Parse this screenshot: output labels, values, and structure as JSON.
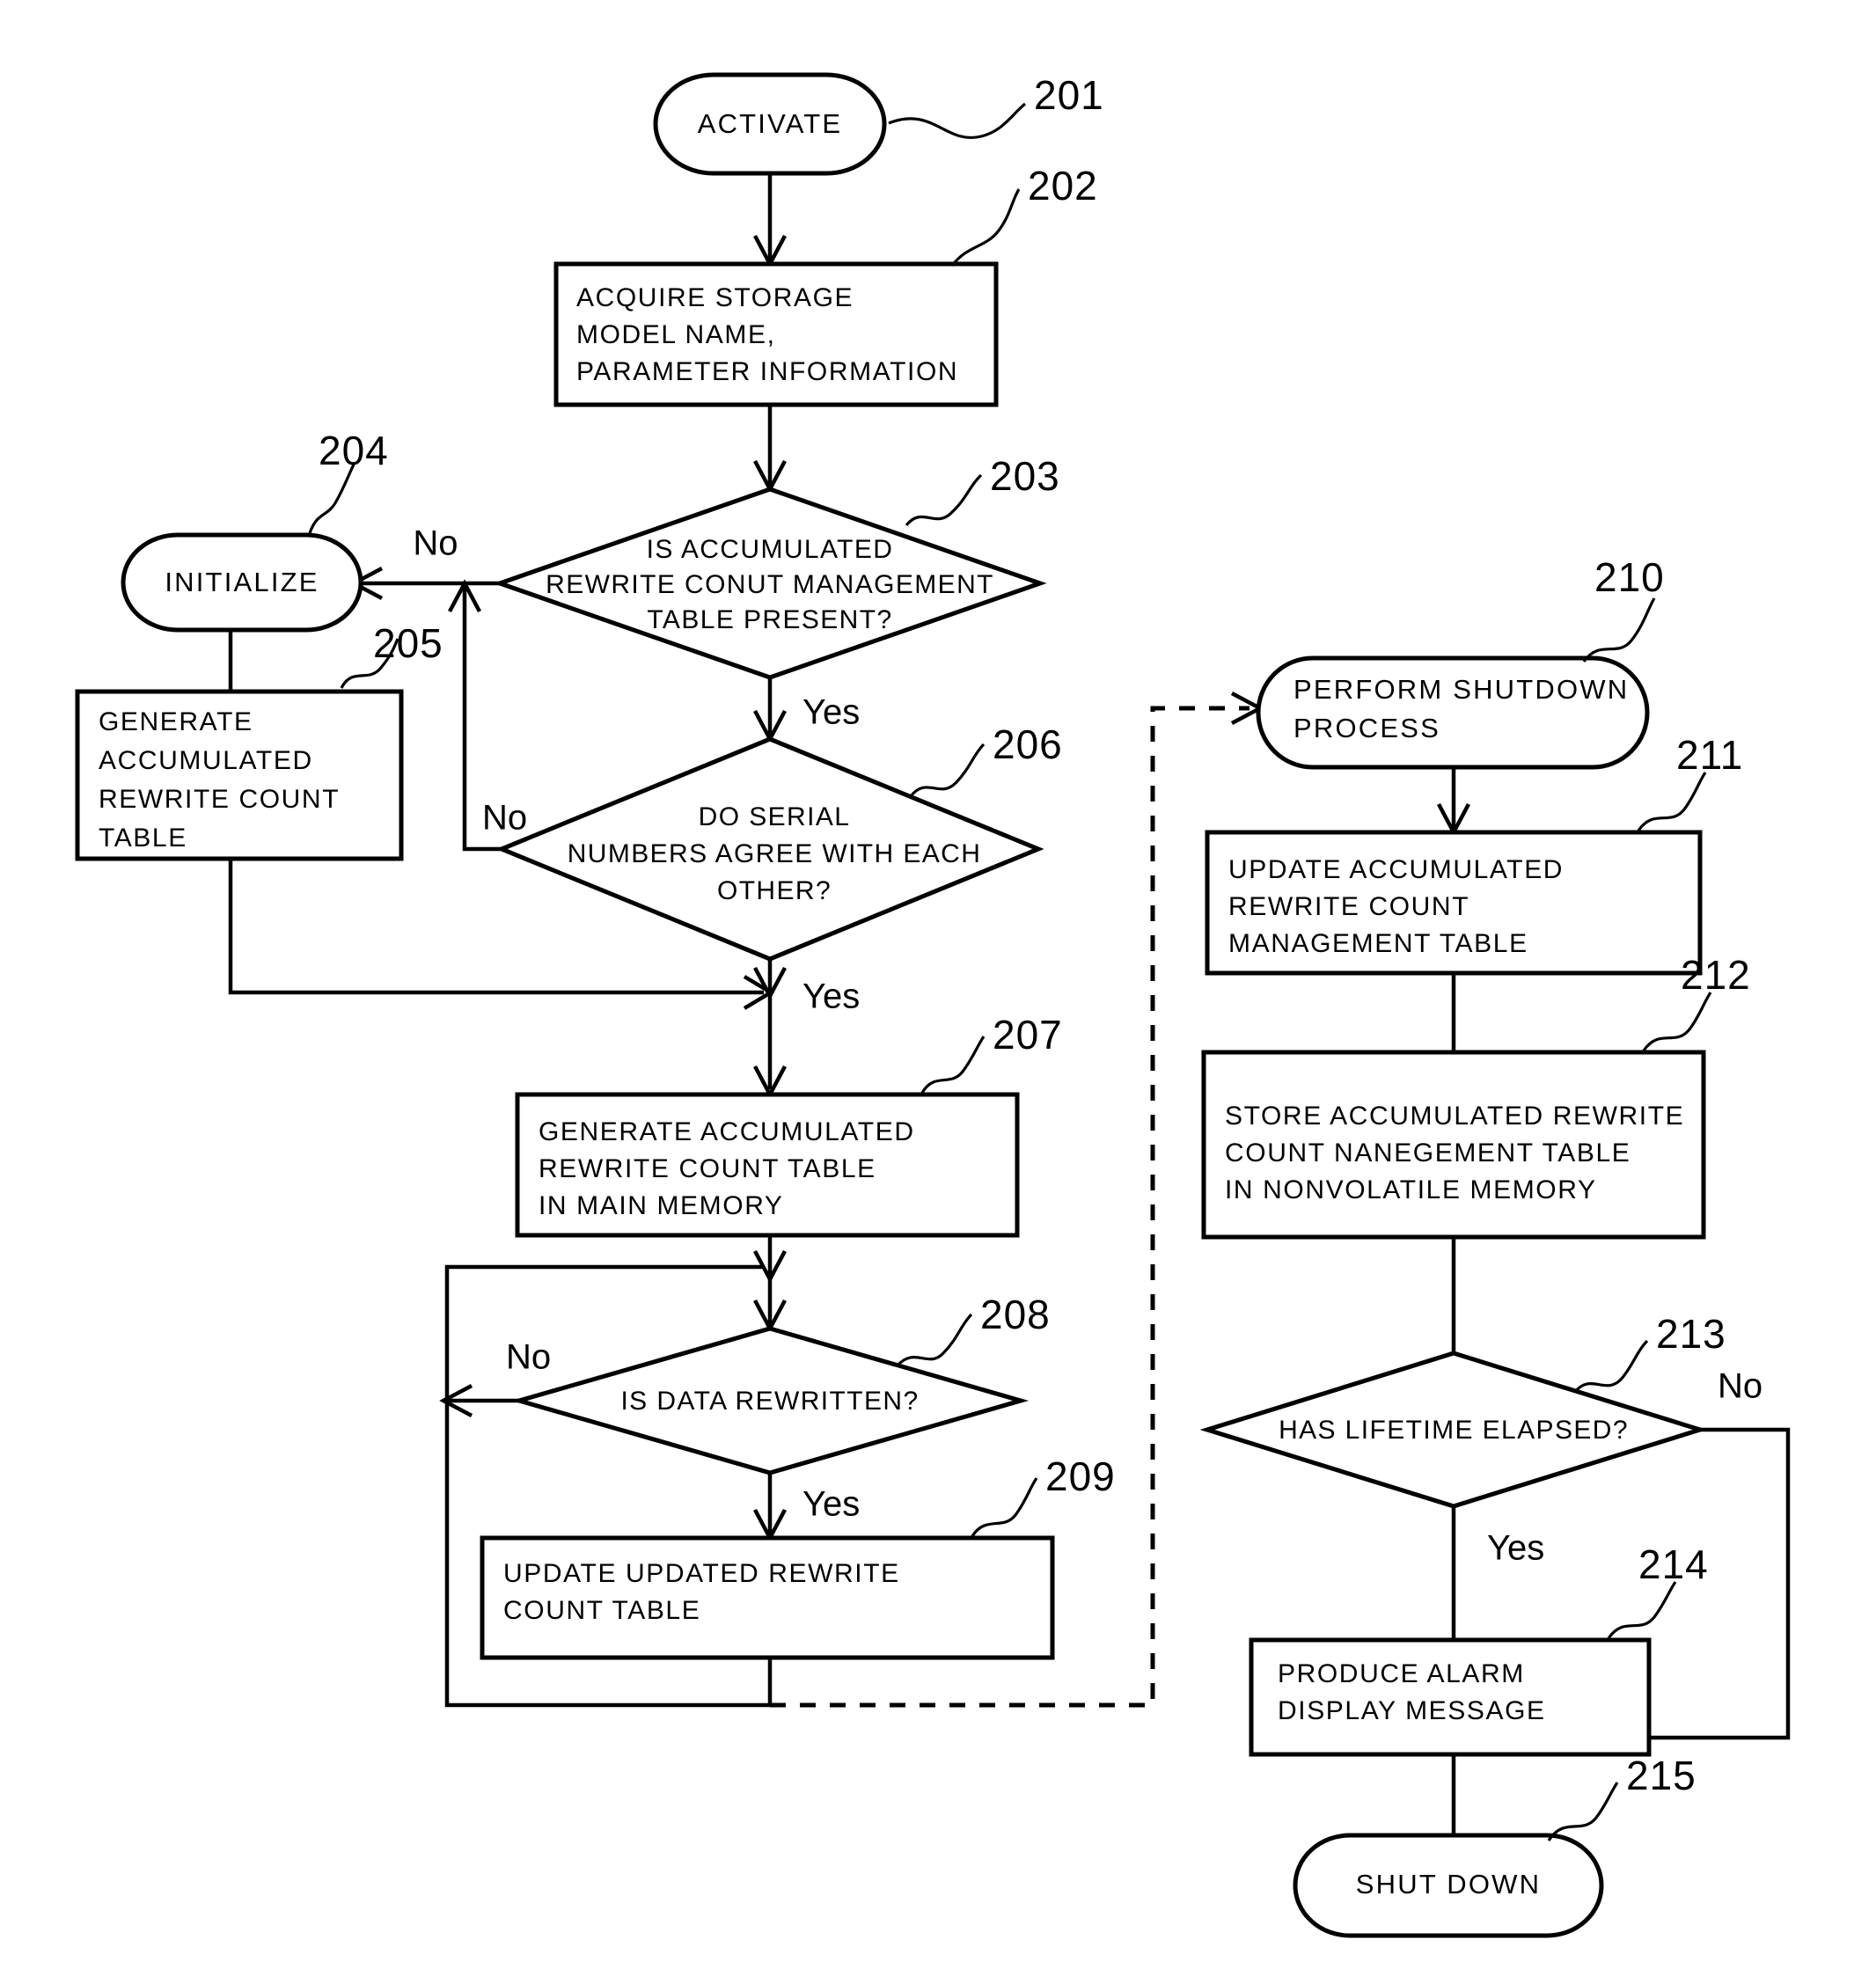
{
  "figure": {
    "type": "flowchart",
    "title": "",
    "nodes": {
      "n201": {
        "ref": "201",
        "label": "ACTIVATE",
        "shape": "terminator"
      },
      "n202": {
        "ref": "202",
        "shape": "process",
        "lines": [
          "ACQUIRE STORAGE",
          "MODEL NAME,",
          "PARAMETER INFORMATION"
        ]
      },
      "n203": {
        "ref": "203",
        "shape": "decision",
        "lines": [
          "IS ACCUMULATED",
          "REWRITE CONUT MANAGEMENT",
          "TABLE PRESENT?"
        ]
      },
      "n204": {
        "ref": "204",
        "label": "INITIALIZE",
        "shape": "terminator"
      },
      "n205": {
        "ref": "205",
        "shape": "process",
        "lines": [
          "GENERATE",
          "ACCUMULATED",
          "REWRITE COUNT",
          "TABLE"
        ]
      },
      "n206": {
        "ref": "206",
        "shape": "decision",
        "lines": [
          "DO SERIAL",
          "NUMBERS AGREE WITH EACH",
          "OTHER?"
        ]
      },
      "n207": {
        "ref": "207",
        "shape": "process",
        "lines": [
          "GENERATE ACCUMULATED",
          "REWRITE COUNT TABLE",
          "IN MAIN MEMORY"
        ]
      },
      "n208": {
        "ref": "208",
        "shape": "decision",
        "lines": [
          "IS DATA REWRITTEN?"
        ]
      },
      "n209": {
        "ref": "209",
        "shape": "process",
        "lines": [
          "UPDATE UPDATED REWRITE",
          "COUNT TABLE"
        ]
      },
      "n210": {
        "ref": "210",
        "shape": "terminator",
        "lines": [
          "PERFORM SHUTDOWN",
          "PROCESS"
        ]
      },
      "n211": {
        "ref": "211",
        "shape": "process",
        "lines": [
          "UPDATE ACCUMULATED",
          "REWRITE COUNT",
          "MANAGEMENT TABLE"
        ]
      },
      "n212": {
        "ref": "212",
        "shape": "process",
        "lines": [
          "STORE ACCUMULATED REWRITE",
          "COUNT NANEGEMENT TABLE",
          "IN NONVOLATILE MEMORY"
        ]
      },
      "n213": {
        "ref": "213",
        "shape": "decision",
        "lines": [
          "HAS LIFETIME ELAPSED?"
        ]
      },
      "n214": {
        "ref": "214",
        "shape": "process",
        "lines": [
          "PRODUCE ALARM",
          "DISPLAY MESSAGE"
        ]
      },
      "n215": {
        "ref": "215",
        "label": "SHUT DOWN",
        "shape": "terminator"
      }
    },
    "branch_labels": {
      "b203_no": "No",
      "b203_yes": "Yes",
      "b206_no": "No",
      "b206_yes": "Yes",
      "b208_no": "No",
      "b208_yes": "Yes",
      "b213_no": "No",
      "b213_yes": "Yes"
    },
    "colors": {
      "ink": "#000000",
      "paper": "#ffffff"
    }
  }
}
